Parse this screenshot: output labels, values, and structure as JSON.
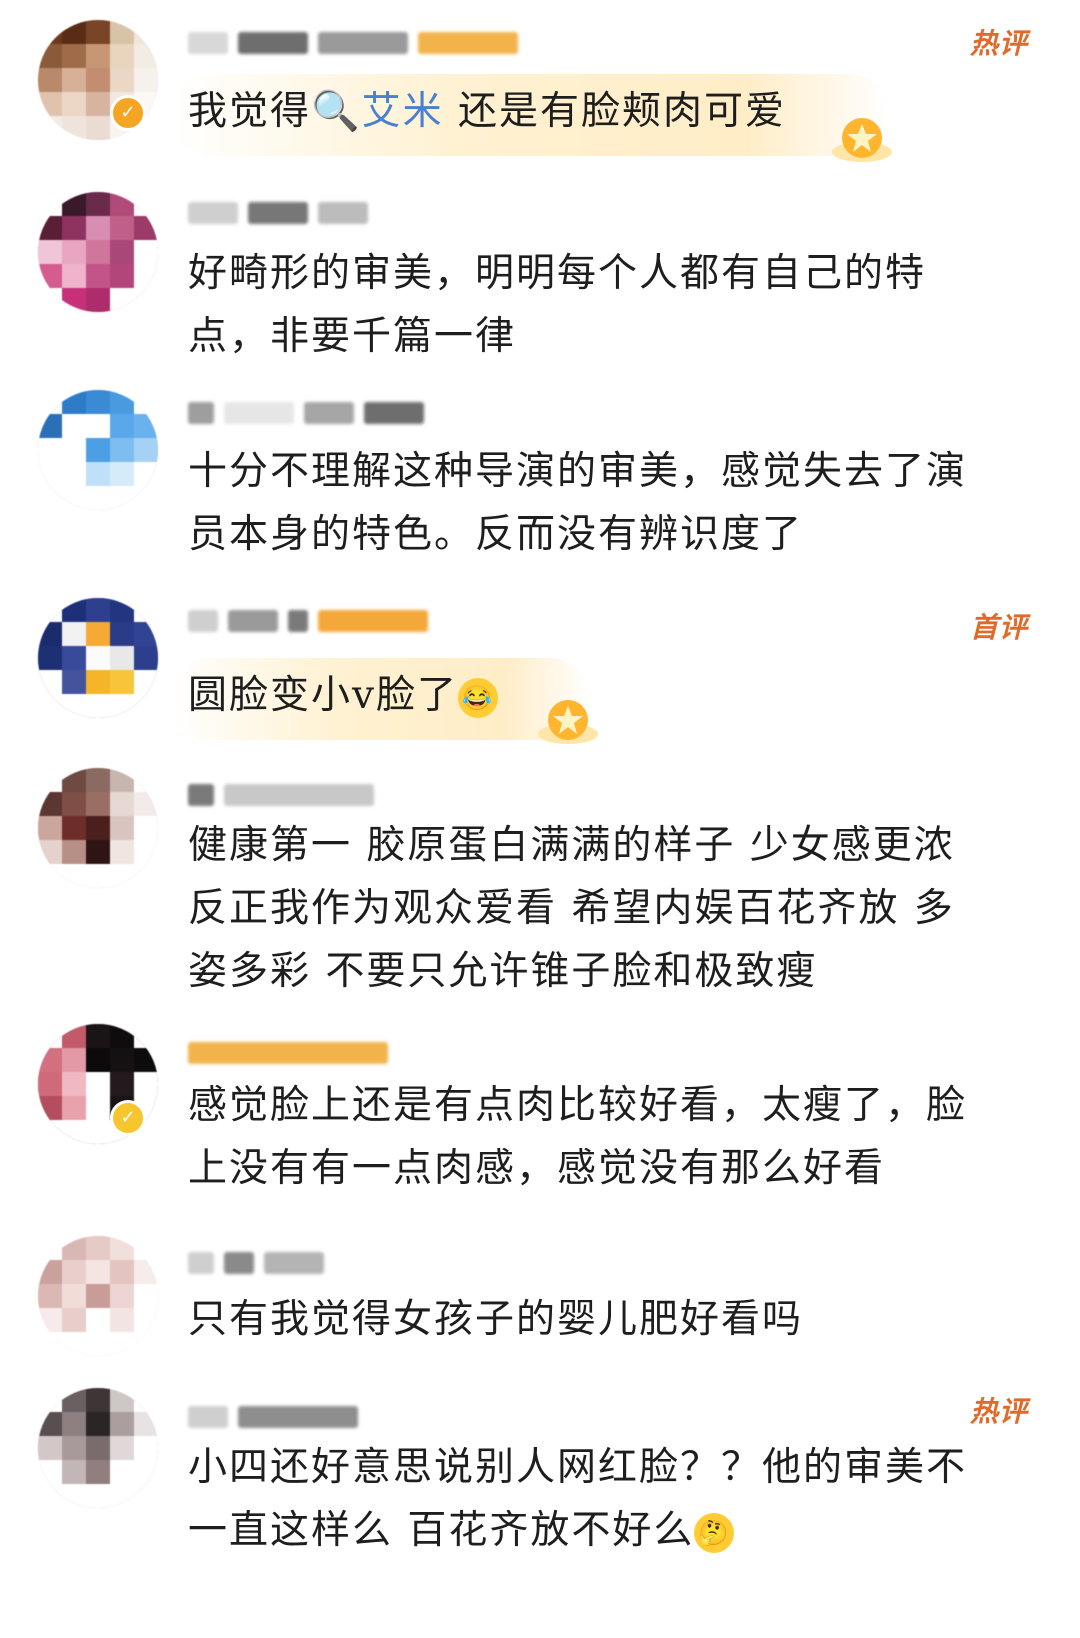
{
  "comments": [
    {
      "text_parts": [
        "我觉得",
        "艾米",
        " 还是有脸颊肉可爱"
      ],
      "tag": "热评",
      "has_star_badge": true
    },
    {
      "lines": [
        "好畸形的审美，明明每个人都有自己的特",
        "点，非要千篇一律"
      ]
    },
    {
      "lines": [
        "十分不理解这种导演的审美，感觉失去了演",
        "员本身的特色。反而没有辨识度了"
      ]
    },
    {
      "text": "圆脸变小v脸了",
      "tag": "首评",
      "emoji": "laughing-tears",
      "has_star_badge": true
    },
    {
      "lines": [
        "健康第一 胶原蛋白满满的样子 少女感更浓",
        "反正我作为观众爱看 希望内娱百花齐放 多",
        "姿多彩 不要只允许锥子脸和极致瘦"
      ]
    },
    {
      "lines": [
        "感觉脸上还是有点肉比较好看，太瘦了，脸",
        "上没有有一点肉感，感觉没有那么好看"
      ]
    },
    {
      "text": "只有我觉得女孩子的婴儿肥好看吗"
    },
    {
      "lines": [
        "小四还好意思说别人网红脸？？他的审美不",
        "一直这样么 百花齐放不好么"
      ],
      "tag": "热评",
      "emoji": "thinking"
    }
  ],
  "colors": {
    "mention": "#4a7fd1",
    "tag": "#e06a28",
    "text": "#1e1e1e"
  }
}
